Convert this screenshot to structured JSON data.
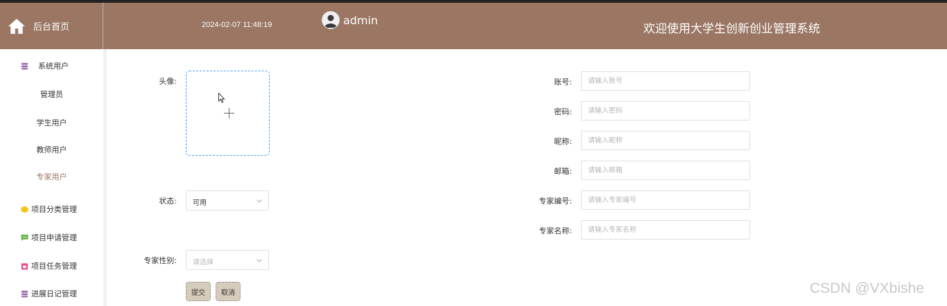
{
  "header": {
    "home_label": "后台首页",
    "datetime": "2024-02-07 11:48:19",
    "username": "admin",
    "system_title": "欢迎使用大学生创新创业管理系统",
    "bg_color": "#9a7663"
  },
  "sidebar": {
    "group_system_users": "系统用户",
    "sub_admin": "管理员",
    "sub_student": "学生用户",
    "sub_teacher": "教师用户",
    "sub_expert": "专家用户",
    "group_category": "项目分类管理",
    "group_application": "项目申请管理",
    "group_task": "项目任务管理",
    "group_diary": "进展日记管理"
  },
  "form": {
    "avatar_label": "头像:",
    "status_label": "状态:",
    "status_value": "可用",
    "gender_label": "专家性别:",
    "gender_placeholder": "请选择",
    "account_label": "账号:",
    "account_placeholder": "请输入账号",
    "password_label": "密码:",
    "password_placeholder": "请输入密码",
    "nickname_label": "昵称:",
    "nickname_placeholder": "请输入昵称",
    "email_label": "邮箱:",
    "email_placeholder": "请输入邮箱",
    "expert_no_label": "专家编号:",
    "expert_no_placeholder": "请输入专家编号",
    "expert_name_label": "专家名称:",
    "expert_name_placeholder": "请输入专家名称",
    "submit_label": "提交",
    "cancel_label": "取消"
  },
  "watermark": "CSDN @VXbishe"
}
